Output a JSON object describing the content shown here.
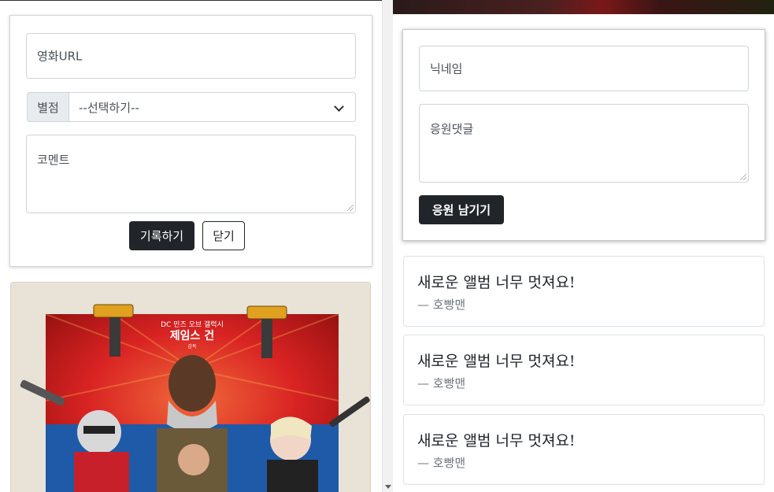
{
  "movie_form": {
    "url_placeholder": "영화URL",
    "rating_label": "별점",
    "rating_selected": "--선택하기--",
    "comment_placeholder": "코멘트",
    "submit_label": "기록하기",
    "close_label": "닫기"
  },
  "poster": {
    "subtitle": "DC 민즈 오브 갤럭시",
    "title": "제임스 건",
    "credit": "감독"
  },
  "cheer_form": {
    "nickname_placeholder": "닉네임",
    "comment_placeholder": "응원댓글",
    "submit_label": "응원 남기기"
  },
  "comments": [
    {
      "message": "새로운 앨범 너무 멋져요!",
      "author": "— 호빵맨"
    },
    {
      "message": "새로운 앨범 너무 멋져요!",
      "author": "— 호빵맨"
    },
    {
      "message": "새로운 앨범 너무 멋져요!",
      "author": "— 호빵맨"
    }
  ],
  "colors": {
    "dark_button": "#212529",
    "border": "#ced4da",
    "addon_bg": "#e9ecef",
    "muted_text": "#6c757d"
  }
}
